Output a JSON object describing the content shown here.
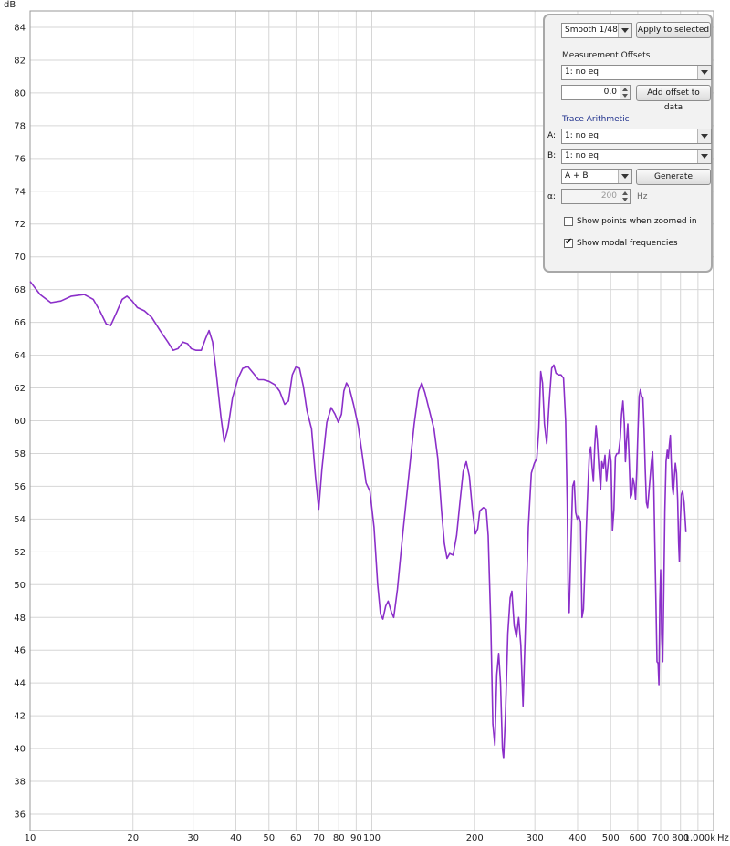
{
  "chart_data": {
    "type": "line",
    "xscale": "log",
    "xlim": [
      10,
      1000
    ],
    "ylim": [
      35,
      85
    ],
    "y_unit": "dB",
    "x_unit": "Hz",
    "grid": true,
    "y_ticks": [
      "36",
      "38",
      "40",
      "42",
      "44",
      "46",
      "48",
      "50",
      "52",
      "54",
      "56",
      "58",
      "60",
      "62",
      "64",
      "66",
      "68",
      "70",
      "72",
      "74",
      "76",
      "78",
      "80",
      "82",
      "84"
    ],
    "x_ticks": [
      {
        "v": 10,
        "label": "10"
      },
      {
        "v": 20,
        "label": "20"
      },
      {
        "v": 30,
        "label": "30"
      },
      {
        "v": 40,
        "label": "40"
      },
      {
        "v": 50,
        "label": "50"
      },
      {
        "v": 60,
        "label": "60"
      },
      {
        "v": 70,
        "label": "70"
      },
      {
        "v": 80,
        "label": "80"
      },
      {
        "v": 90,
        "label": "90"
      },
      {
        "v": 100,
        "label": "100"
      },
      {
        "v": 200,
        "label": "200"
      },
      {
        "v": 300,
        "label": "300"
      },
      {
        "v": 400,
        "label": "400"
      },
      {
        "v": 500,
        "label": "500"
      },
      {
        "v": 600,
        "label": "600"
      },
      {
        "v": 700,
        "label": "700"
      },
      {
        "v": 800,
        "label": "800"
      },
      {
        "v": 900,
        "label": ""
      },
      {
        "v": 1000,
        "label": "1,000k"
      }
    ],
    "series": [
      {
        "color": "#8b2fc9",
        "points": [
          [
            10,
            68.5
          ],
          [
            10.7,
            67.7
          ],
          [
            11.5,
            67.2
          ],
          [
            12.3,
            67.3
          ],
          [
            13.2,
            67.6
          ],
          [
            14.4,
            67.7
          ],
          [
            15.3,
            67.4
          ],
          [
            16.0,
            66.7
          ],
          [
            16.7,
            65.9
          ],
          [
            17.2,
            65.8
          ],
          [
            17.9,
            66.6
          ],
          [
            18.6,
            67.4
          ],
          [
            19.2,
            67.6
          ],
          [
            19.9,
            67.3
          ],
          [
            20.6,
            66.9
          ],
          [
            21.6,
            66.7
          ],
          [
            22.7,
            66.3
          ],
          [
            24.0,
            65.5
          ],
          [
            25.3,
            64.8
          ],
          [
            26.2,
            64.3
          ],
          [
            27.1,
            64.4
          ],
          [
            28.0,
            64.8
          ],
          [
            28.9,
            64.7
          ],
          [
            29.6,
            64.4
          ],
          [
            30.6,
            64.3
          ],
          [
            31.7,
            64.3
          ],
          [
            32.6,
            65.0
          ],
          [
            33.4,
            65.5
          ],
          [
            34.2,
            64.8
          ],
          [
            35.0,
            63.0
          ],
          [
            36.2,
            60.2
          ],
          [
            37.0,
            58.7
          ],
          [
            37.9,
            59.5
          ],
          [
            39.1,
            61.4
          ],
          [
            40.6,
            62.6
          ],
          [
            41.9,
            63.2
          ],
          [
            43.4,
            63.3
          ],
          [
            45.0,
            62.9
          ],
          [
            46.6,
            62.5
          ],
          [
            48.2,
            62.5
          ],
          [
            50.0,
            62.4
          ],
          [
            52.0,
            62.2
          ],
          [
            53.7,
            61.8
          ],
          [
            55.6,
            61.0
          ],
          [
            57.0,
            61.2
          ],
          [
            58.5,
            62.8
          ],
          [
            60.0,
            63.3
          ],
          [
            61.4,
            63.2
          ],
          [
            63.0,
            62.1
          ],
          [
            64.6,
            60.6
          ],
          [
            66.6,
            59.5
          ],
          [
            68.4,
            56.6
          ],
          [
            69.9,
            54.6
          ],
          [
            71.4,
            57.0
          ],
          [
            73.8,
            59.9
          ],
          [
            76.0,
            60.8
          ],
          [
            78.0,
            60.4
          ],
          [
            79.8,
            59.9
          ],
          [
            81.5,
            60.4
          ],
          [
            82.8,
            61.8
          ],
          [
            84.3,
            62.3
          ],
          [
            85.9,
            62.0
          ],
          [
            88.4,
            61.0
          ],
          [
            91.2,
            59.7
          ],
          [
            93.9,
            57.8
          ],
          [
            96.2,
            56.2
          ],
          [
            98.7,
            55.7
          ],
          [
            101.5,
            53.5
          ],
          [
            104.0,
            50.0
          ],
          [
            106.0,
            48.2
          ],
          [
            107.7,
            47.9
          ],
          [
            109.8,
            48.7
          ],
          [
            111.6,
            49.0
          ],
          [
            114.2,
            48.3
          ],
          [
            115.9,
            48.0
          ],
          [
            118.8,
            49.7
          ],
          [
            123.0,
            53.0
          ],
          [
            128.0,
            56.5
          ],
          [
            133.0,
            59.8
          ],
          [
            137.0,
            61.8
          ],
          [
            140.0,
            62.3
          ],
          [
            143.0,
            61.7
          ],
          [
            147.0,
            60.7
          ],
          [
            152.0,
            59.5
          ],
          [
            156.0,
            57.7
          ],
          [
            160.0,
            54.5
          ],
          [
            163.0,
            52.5
          ],
          [
            166.0,
            51.6
          ],
          [
            169.0,
            51.9
          ],
          [
            173.0,
            51.8
          ],
          [
            177.0,
            53.0
          ],
          [
            181.0,
            55.0
          ],
          [
            185.0,
            56.9
          ],
          [
            189.0,
            57.5
          ],
          [
            193.0,
            56.6
          ],
          [
            197.0,
            54.5
          ],
          [
            201.0,
            53.1
          ],
          [
            204.0,
            53.4
          ],
          [
            207.0,
            54.5
          ],
          [
            212.0,
            54.7
          ],
          [
            216.0,
            54.6
          ],
          [
            219.0,
            53.0
          ],
          [
            223.0,
            47.5
          ],
          [
            226.0,
            41.5
          ],
          [
            229.0,
            40.2
          ],
          [
            232.0,
            44.5
          ],
          [
            235.0,
            45.8
          ],
          [
            238.0,
            44.0
          ],
          [
            241.0,
            40.0
          ],
          [
            243.0,
            39.4
          ],
          [
            246.0,
            42.0
          ],
          [
            250.0,
            47.0
          ],
          [
            254.0,
            49.2
          ],
          [
            257.0,
            49.6
          ],
          [
            261.0,
            47.5
          ],
          [
            265.0,
            46.8
          ],
          [
            269.0,
            48.0
          ],
          [
            273.0,
            46.3
          ],
          [
            277.0,
            42.6
          ],
          [
            281.0,
            46.8
          ],
          [
            287.0,
            53.5
          ],
          [
            293.0,
            56.8
          ],
          [
            299.0,
            57.4
          ],
          [
            304.0,
            57.7
          ],
          [
            308.0,
            59.5
          ],
          [
            312.0,
            63.0
          ],
          [
            316.0,
            62.3
          ],
          [
            320.0,
            59.8
          ],
          [
            325.0,
            58.6
          ],
          [
            330.0,
            61.0
          ],
          [
            336.0,
            63.2
          ],
          [
            341.0,
            63.4
          ],
          [
            346.0,
            62.9
          ],
          [
            352.0,
            62.8
          ],
          [
            358.0,
            62.8
          ],
          [
            364.0,
            62.6
          ],
          [
            369.0,
            60.0
          ],
          [
            373.0,
            55.0
          ],
          [
            376.0,
            48.5
          ],
          [
            378.0,
            48.3
          ],
          [
            382.0,
            52.0
          ],
          [
            387.0,
            56.0
          ],
          [
            391.0,
            56.3
          ],
          [
            395.0,
            54.4
          ],
          [
            399.0,
            54.0
          ],
          [
            403.0,
            54.2
          ],
          [
            408.0,
            53.8
          ],
          [
            412.0,
            48.0
          ],
          [
            416.0,
            48.5
          ],
          [
            421.0,
            51.5
          ],
          [
            427.0,
            55.0
          ],
          [
            433.0,
            58.0
          ],
          [
            437.0,
            58.4
          ],
          [
            441.0,
            57.2
          ],
          [
            445.0,
            56.3
          ],
          [
            449.0,
            58.5
          ],
          [
            453.0,
            59.7
          ],
          [
            457.0,
            58.8
          ],
          [
            462.0,
            57.1
          ],
          [
            467.0,
            55.8
          ],
          [
            471.0,
            57.5
          ],
          [
            476.0,
            57.1
          ],
          [
            481.0,
            57.9
          ],
          [
            486.0,
            56.3
          ],
          [
            491.0,
            57.3
          ],
          [
            496.0,
            58.2
          ],
          [
            501.0,
            57.5
          ],
          [
            506.0,
            53.3
          ],
          [
            511.0,
            54.6
          ],
          [
            516.0,
            57.8
          ],
          [
            521.0,
            58.0
          ],
          [
            527.0,
            58.0
          ],
          [
            533.0,
            58.9
          ],
          [
            538.0,
            60.4
          ],
          [
            543.0,
            61.2
          ],
          [
            548.0,
            59.8
          ],
          [
            552.0,
            57.5
          ],
          [
            556.0,
            58.7
          ],
          [
            561.0,
            59.8
          ],
          [
            566.0,
            57.8
          ],
          [
            571.0,
            55.3
          ],
          [
            576.0,
            55.5
          ],
          [
            581.0,
            56.5
          ],
          [
            586.0,
            56.1
          ],
          [
            591.0,
            55.2
          ],
          [
            596.0,
            57.0
          ],
          [
            601.0,
            59.5
          ],
          [
            606.0,
            61.5
          ],
          [
            611.0,
            61.9
          ],
          [
            616.0,
            61.5
          ],
          [
            621.0,
            61.4
          ],
          [
            626.0,
            59.5
          ],
          [
            631.0,
            57.0
          ],
          [
            636.0,
            55.0
          ],
          [
            641.0,
            54.7
          ],
          [
            646.0,
            55.5
          ],
          [
            652.0,
            56.5
          ],
          [
            658.0,
            57.5
          ],
          [
            663.0,
            58.1
          ],
          [
            668.0,
            56.2
          ],
          [
            673.0,
            52.5
          ],
          [
            678.0,
            49.0
          ],
          [
            683.0,
            45.3
          ],
          [
            688.0,
            45.2
          ],
          [
            692.0,
            43.9
          ],
          [
            696.0,
            49.0
          ],
          [
            700.0,
            50.9
          ],
          [
            705.0,
            47.0
          ],
          [
            710.0,
            45.3
          ],
          [
            715.0,
            49.5
          ],
          [
            720.0,
            54.5
          ],
          [
            726.0,
            57.5
          ],
          [
            732.0,
            58.2
          ],
          [
            737.0,
            57.7
          ],
          [
            742.0,
            58.5
          ],
          [
            747.0,
            59.1
          ],
          [
            752.0,
            57.5
          ],
          [
            757.0,
            56.0
          ],
          [
            762.0,
            55.5
          ],
          [
            767.0,
            56.5
          ],
          [
            773.0,
            57.4
          ],
          [
            779.0,
            56.8
          ],
          [
            785.0,
            55.2
          ],
          [
            790.0,
            52.5
          ],
          [
            794.0,
            51.4
          ],
          [
            799.0,
            53.8
          ],
          [
            805.0,
            55.5
          ],
          [
            812.0,
            55.7
          ],
          [
            820.0,
            55.0
          ],
          [
            830.0,
            53.2
          ]
        ]
      }
    ]
  },
  "panel": {
    "smoothing": "Smooth 1/48",
    "apply_label": "Apply to selected",
    "offsets_title": "Measurement Offsets",
    "offset_measurement": "1: no eq",
    "offset_value": "0,0",
    "add_offset_label": "Add offset to data",
    "arith_title": "Trace Arithmetic",
    "a_label": "A:",
    "a_value": "1: no eq",
    "b_label": "B:",
    "b_value": "1: no eq",
    "operation": "A + B",
    "generate_label": "Generate",
    "alpha_label": "α:",
    "alpha_value": "200",
    "alpha_unit": "Hz",
    "show_points_label": "Show points when zoomed in",
    "show_points_checked": false,
    "show_modal_label": "Show modal frequencies",
    "show_modal_checked": true
  }
}
